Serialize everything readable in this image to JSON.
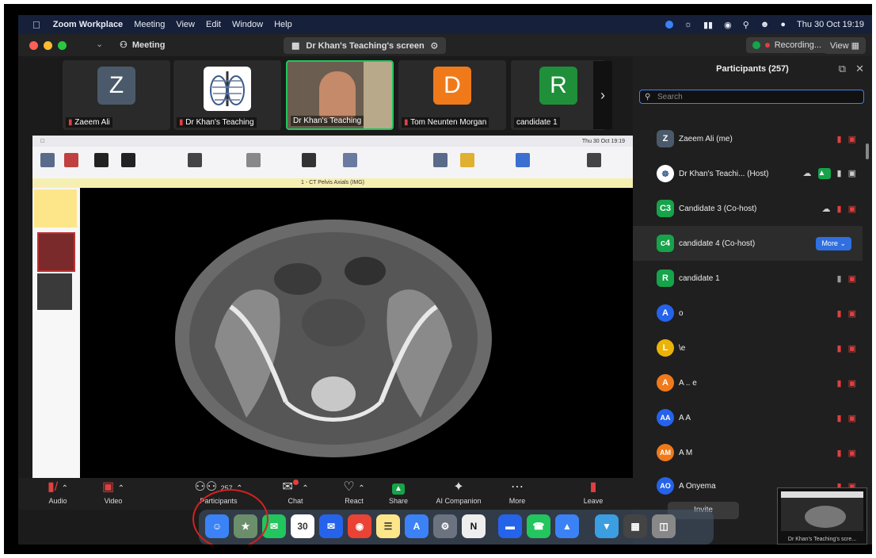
{
  "menubar": {
    "app": "Zoom Workplace",
    "items": [
      "Meeting",
      "View",
      "Edit",
      "Window",
      "Help"
    ],
    "datetime": "Thu 30 Oct 19:19"
  },
  "titlebar": {
    "meeting": "Meeting",
    "share_title": "Dr Khan's Teaching's screen",
    "recording": "Recording...",
    "view": "View"
  },
  "video_tiles": [
    {
      "initial": "Z",
      "name": "Zaeem Ali",
      "color": "#4a5a6a"
    },
    {
      "initial": "",
      "name": "Dr Khan's Teaching",
      "color": "#ffffff"
    },
    {
      "initial": "",
      "name": "Dr Khan's Teaching",
      "color": "#7a6a5a"
    },
    {
      "initial": "D",
      "name": "Tom Neunten Morgan",
      "color": "#f07a1a"
    },
    {
      "initial": "R",
      "name": "candidate 1",
      "color": "#1f8f3a"
    }
  ],
  "shared": {
    "osx_time": "Thu 30 Oct 19:19",
    "yellow_bar": "1 - CT Pelvis Axials (IMG)"
  },
  "participants": {
    "title": "Participants (257)",
    "search_placeholder": "Search",
    "more_label": "More",
    "invite_label": "Invite",
    "list": [
      {
        "initial": "Z",
        "name": "Zaeem Ali (me)",
        "color": "#4a5a6a"
      },
      {
        "initial": "",
        "name": "Dr Khan's Teachi... (Host)",
        "color": "#ffffff"
      },
      {
        "initial": "C3",
        "name": "Candidate 3 (Co-host)",
        "color": "#16a34a"
      },
      {
        "initial": "c4",
        "name": "candidate 4 (Co-host)",
        "color": "#16a34a"
      },
      {
        "initial": "R",
        "name": "candidate 1",
        "color": "#16a34a"
      },
      {
        "initial": "A",
        "name": "o",
        "color": "#2563eb"
      },
      {
        "initial": "L",
        "name": "\\e",
        "color": "#eab308"
      },
      {
        "initial": "A",
        "name": "A .. e",
        "color": "#f07a1a"
      },
      {
        "initial": "AA",
        "name": "A A",
        "color": "#2563eb"
      },
      {
        "initial": "AM",
        "name": "A M",
        "color": "#f07a1a"
      },
      {
        "initial": "AO",
        "name": "A Onyema",
        "color": "#2563eb"
      }
    ]
  },
  "toolbar": {
    "audio": "Audio",
    "video": "Video",
    "participants": "Participants",
    "participants_count": "257",
    "chat": "Chat",
    "react": "React",
    "share": "Share",
    "ai": "AI Companion",
    "more": "More",
    "leave": "Leave"
  },
  "dock": {
    "calendar_day": "30"
  },
  "thumbnail": {
    "caption": "Dr Khan's Teaching's scre..."
  }
}
